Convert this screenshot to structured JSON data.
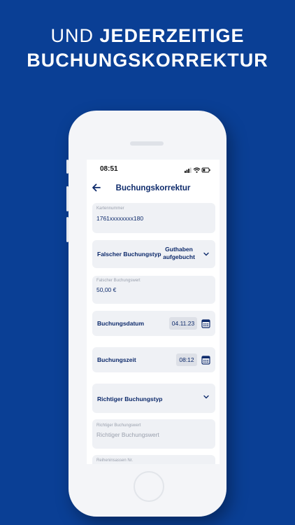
{
  "headline": {
    "light": "UND ",
    "bold_1": "JEDERZEITIGE",
    "line2": "BUCHUNGSKORREKTUR"
  },
  "status_bar": {
    "time": "08:51"
  },
  "nav": {
    "title": "Buchungskorrektur"
  },
  "form": {
    "card_number": {
      "label": "Kartennummer",
      "value": "1761xxxxxxxx180"
    },
    "wrong_type": {
      "label": "Falscher Buchungstyp",
      "value_line1": "Guthaben",
      "value_line2": "aufgebucht"
    },
    "wrong_value": {
      "label": "Falscher Buchungswert",
      "value": "50,00 €"
    },
    "booking_date": {
      "label": "Buchungsdatum",
      "value": "04.11.23"
    },
    "booking_time": {
      "label": "Buchungszeit",
      "value": "08:12"
    },
    "correct_type": {
      "label": "Richtiger Buchungstyp"
    },
    "correct_value": {
      "label": "Richtiger Buchungswert",
      "placeholder": "Richtiger Buchungswert"
    },
    "next_field": {
      "label": "Reiheninsassen Nr."
    }
  },
  "colors": {
    "background": "#0a3f95",
    "accent": "#0d2a6b",
    "field": "#eff1f5"
  }
}
